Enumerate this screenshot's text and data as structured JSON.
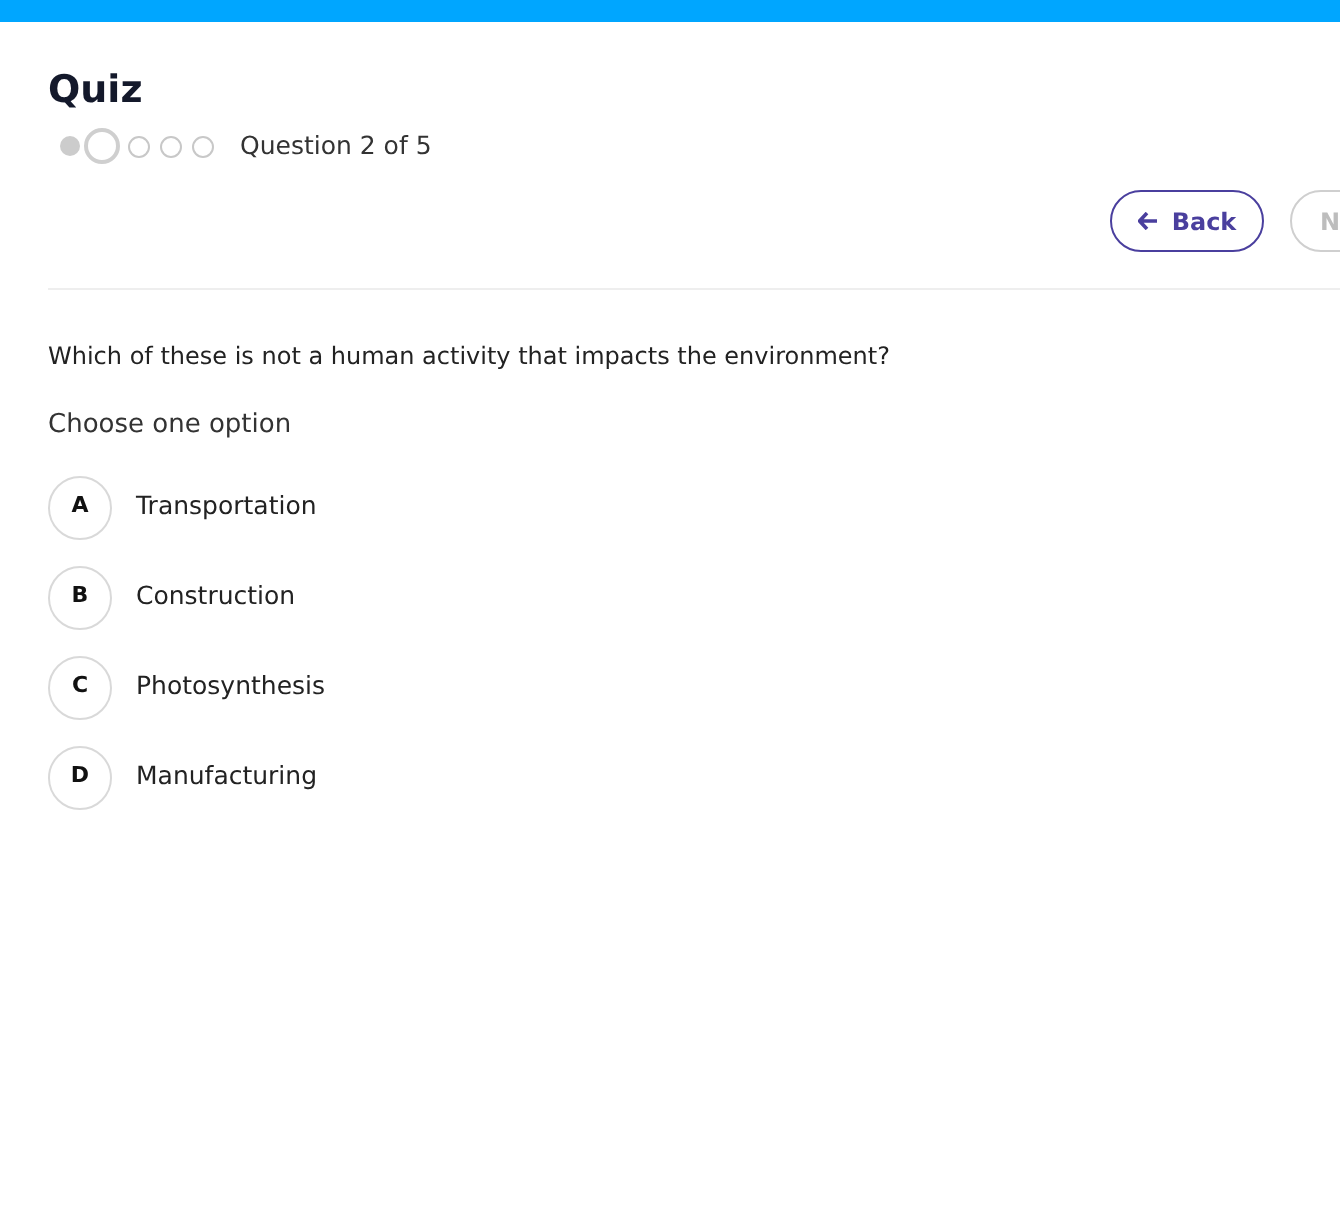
{
  "title": "Quiz",
  "progress": {
    "steps": [
      {
        "done": true,
        "selected": false
      },
      {
        "done": false,
        "selected": true
      },
      {
        "done": false,
        "selected": false
      },
      {
        "done": false,
        "selected": false
      },
      {
        "done": false,
        "selected": false
      }
    ],
    "label": "Question 2 of 5"
  },
  "buttons": [
    {
      "label": "Back",
      "disabled": false
    },
    {
      "label": "N",
      "disabled": true
    }
  ],
  "question": "Which of these is not a human activity that impacts the environment?",
  "instruction": "Choose one option",
  "options": [
    {
      "letter": "A",
      "text": "Transportation",
      "selected": false
    },
    {
      "letter": "B",
      "text": "Construction",
      "selected": false
    },
    {
      "letter": "C",
      "text": "Photosynthesis",
      "selected": false
    },
    {
      "letter": "D",
      "text": "Manufacturing",
      "selected": false
    }
  ]
}
